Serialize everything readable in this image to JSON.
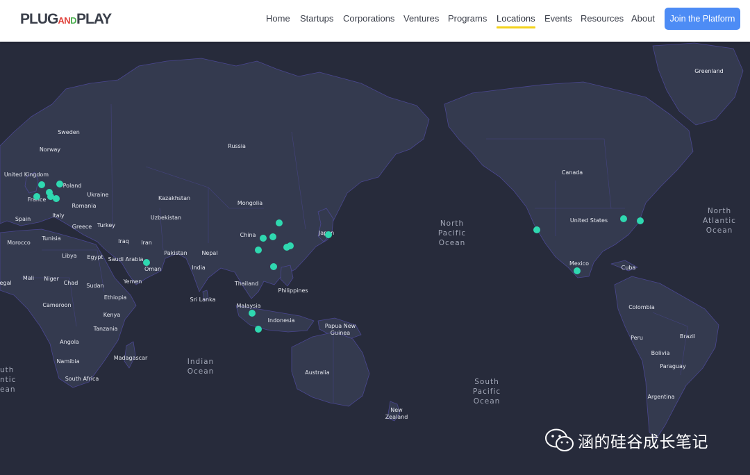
{
  "brand": {
    "logo_parts": [
      {
        "text": "PLUG",
        "color": "#3a3f4a",
        "small": false
      },
      {
        "text": "AN",
        "color": "#e0413a",
        "small": true
      },
      {
        "text": "D",
        "color": "#4caf50",
        "small": true
      },
      {
        "text": "PLAY",
        "color": "#3a3f4a",
        "small": false
      }
    ]
  },
  "nav": {
    "items": [
      "Home",
      "Startups",
      "Corporations",
      "Ventures",
      "Programs",
      "Locations",
      "Events",
      "Resources",
      "About"
    ],
    "active": "Locations",
    "cta_label": "Join the Platform"
  },
  "colors": {
    "map_bg": "#272b3b",
    "land": "#343a4f",
    "border": "#4a4790",
    "marker": "#2fd8b0",
    "nav_accent": "#f3d21c",
    "cta": "#4d8cf5"
  },
  "map": {
    "country_labels": [
      "Greenland",
      "Sweden",
      "Norway",
      "Russia",
      "United Kingdom",
      "Poland",
      "Ukraine",
      "France",
      "Kazakhstan",
      "Mongolia",
      "Canada",
      "Romania",
      "Spain",
      "Italy",
      "Uzbekistan",
      "Greece",
      "Turkey",
      "China",
      "Japan",
      "Morocco",
      "Tunisia",
      "Iraq",
      "Iran",
      "United States",
      "Libya",
      "Egypt",
      "Pakistan",
      "Nepal",
      "Saudi Arabia",
      "India",
      "Oman",
      "Mexico",
      "Cuba",
      "Mali",
      "Niger",
      "Chad",
      "Sudan",
      "Yemen",
      "Thailand",
      "Philippines",
      "Sri Lanka",
      "Cameroon",
      "Ethiopia",
      "Malaysia",
      "Colombia",
      "Kenya",
      "Indonesia",
      "Papua New Guinea",
      "Tanzania",
      "Peru",
      "Brazil",
      "Angola",
      "Bolivia",
      "Madagascar",
      "Namibia",
      "Paraguay",
      "South Africa",
      "Australia",
      "Argentina",
      "New Zealand"
    ],
    "ocean_labels": [
      "North Pacific Ocean",
      "North Atlantic Ocean",
      "Indian Ocean",
      "South Pacific Ocean",
      "uth ntic ean"
    ],
    "partial_labels": [
      "egal"
    ],
    "locations_count": 22
  },
  "watermark": {
    "text": "涵的硅谷成长笔记",
    "icon": "wechat-icon"
  }
}
